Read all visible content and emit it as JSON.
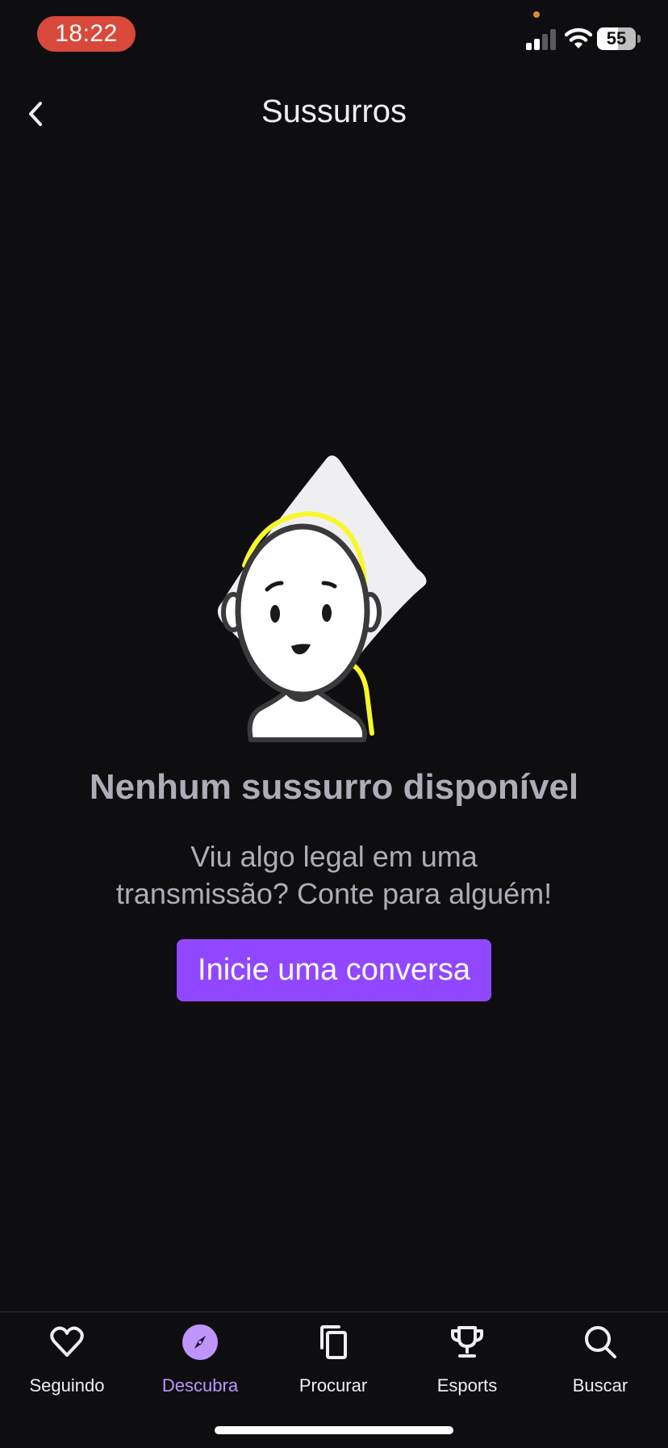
{
  "status_bar": {
    "time": "18:22",
    "battery_percent": 55,
    "battery_text": "55",
    "signal_icon": "cellular-signal-icon",
    "wifi_icon": "wifi-icon",
    "battery_icon": "battery-icon"
  },
  "header": {
    "title": "Sussurros",
    "back_icon": "chevron-left-icon"
  },
  "empty_state": {
    "illustration": "person-with-pillow-illustration",
    "title": "Nenhum sussurro disponível",
    "description_line1": "Viu algo legal em uma",
    "description_line2": "transmissão? Conte para alguém!",
    "cta_label": "Inicie uma conversa"
  },
  "tab_bar": {
    "tabs": [
      {
        "label": "Seguindo",
        "icon": "heart-icon",
        "active": false
      },
      {
        "label": "Descubra",
        "icon": "compass-icon",
        "active": true
      },
      {
        "label": "Procurar",
        "icon": "copy-icon",
        "active": false
      },
      {
        "label": "Esports",
        "icon": "trophy-icon",
        "active": false
      },
      {
        "label": "Buscar",
        "icon": "search-icon",
        "active": false
      }
    ]
  },
  "colors": {
    "background": "#0e0e10",
    "accent": "#9147ff",
    "active_tab": "#bf94ff",
    "time_pill": "#d9493b",
    "muted_text": "#adadb8"
  }
}
